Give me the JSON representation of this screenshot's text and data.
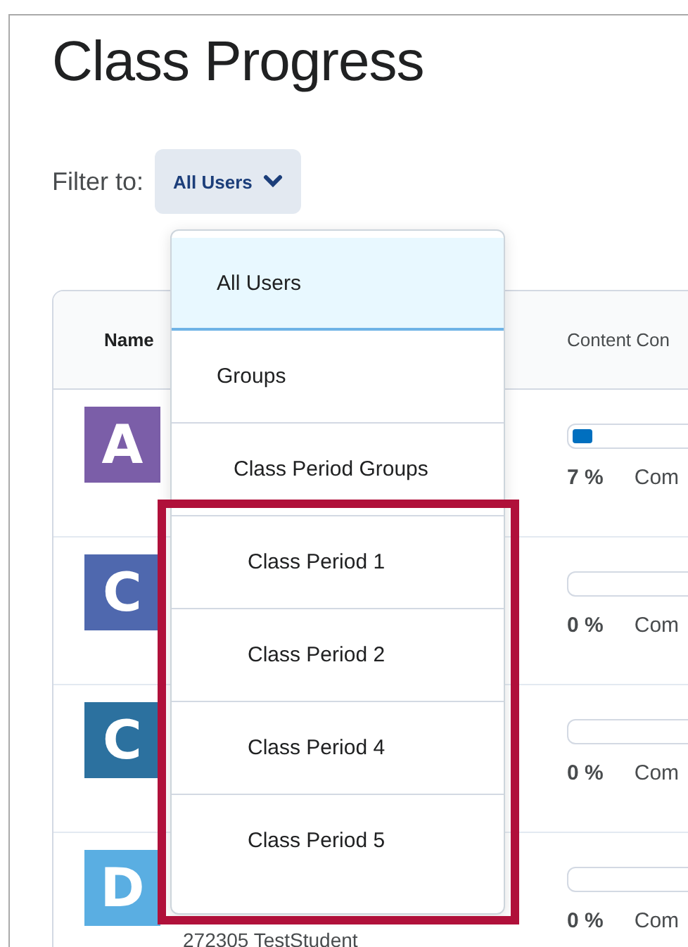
{
  "title": "Class Progress",
  "filter": {
    "label": "Filter to:",
    "value": "All Users",
    "expanded": true
  },
  "menu": [
    {
      "label": "All Users",
      "selected": true,
      "indented": false
    },
    {
      "label": "Groups",
      "selected": false,
      "indented": false
    },
    {
      "label": "Class Period Groups",
      "selected": false,
      "indented": true
    }
  ],
  "highlighted_menu_items": [
    {
      "label": "Class Period 1",
      "selected": false,
      "indented": true
    },
    {
      "label": "Class Period 2",
      "selected": false,
      "indented": true
    },
    {
      "label": "Class Period 4",
      "selected": false,
      "indented": true
    },
    {
      "label": "Class Period 5",
      "selected": false,
      "indented": true
    }
  ],
  "table": {
    "columns": [
      "Name",
      "Content Con"
    ],
    "rows": [
      {
        "avatar": "A",
        "color": "#7b5ea8",
        "level": 0.07,
        "percent": "7 %",
        "status": "Com"
      },
      {
        "avatar": "C",
        "color": "#4f68ae",
        "percent": "0 %",
        "status": "Com"
      },
      {
        "avatar": "C",
        "color": "#2c719f",
        "percent": "0 %",
        "status": "Com"
      },
      {
        "avatar": "D",
        "color": "#5aaee2",
        "percent": "0 %",
        "status": "Com",
        "name": "272305  TestStudent"
      }
    ]
  }
}
